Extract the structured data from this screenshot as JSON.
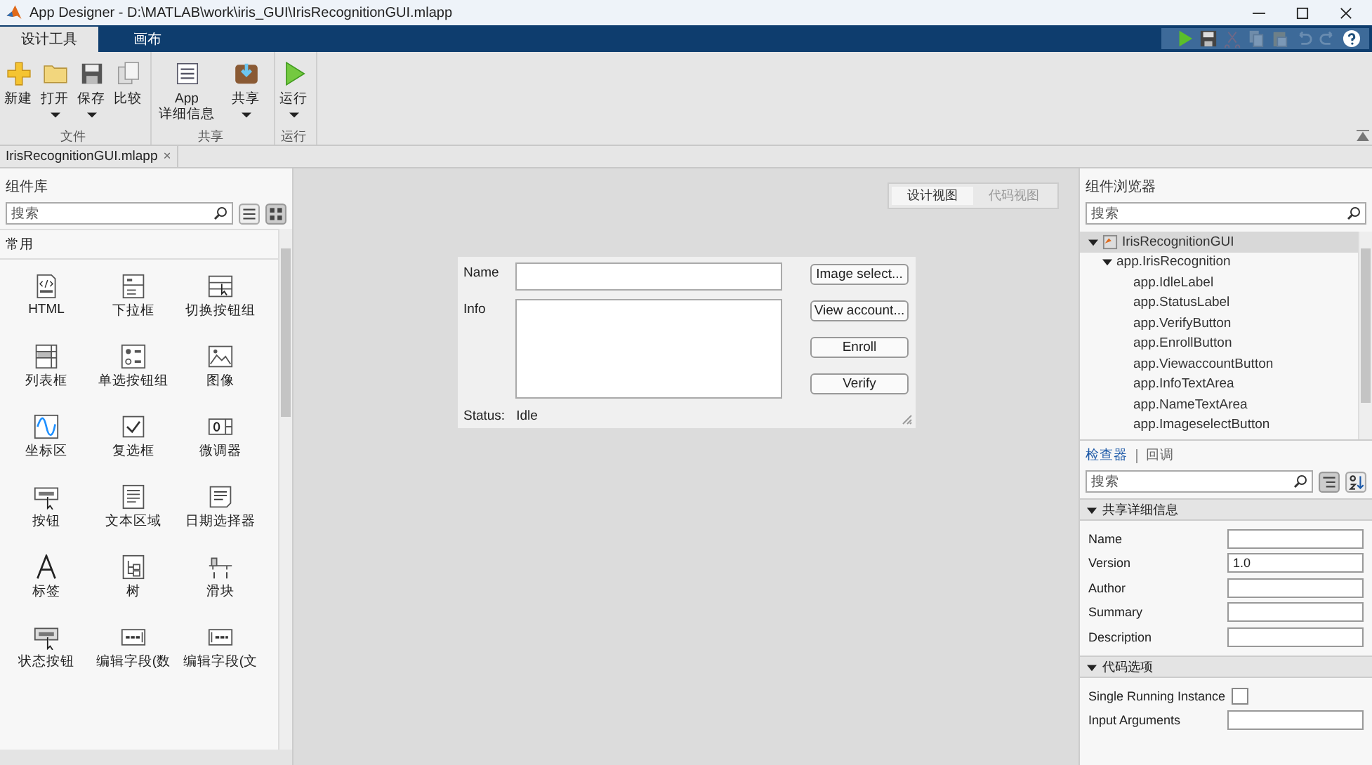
{
  "window": {
    "title": "App Designer - D:\\MATLAB\\work\\iris_GUI\\IrisRecognitionGUI.mlapp"
  },
  "ribbon_tabs": [
    {
      "label": "设计工具",
      "selected": true
    },
    {
      "label": "画布",
      "selected": false
    }
  ],
  "quick_access": [
    {
      "kind": "run",
      "disabled": false
    },
    {
      "kind": "save",
      "disabled": false
    },
    {
      "kind": "cut",
      "disabled": true
    },
    {
      "kind": "copy",
      "disabled": true
    },
    {
      "kind": "paste",
      "disabled": true
    },
    {
      "kind": "undo",
      "disabled": true
    },
    {
      "kind": "redo",
      "disabled": true
    },
    {
      "kind": "help",
      "disabled": false
    }
  ],
  "toolstrip_groups": [
    {
      "title": "文件",
      "buttons": [
        {
          "kind": "new",
          "label": "新建",
          "dropdown": false
        },
        {
          "kind": "open",
          "label": "打开",
          "dropdown": true
        },
        {
          "kind": "save",
          "label": "保存",
          "dropdown": true
        },
        {
          "kind": "compare",
          "label": "比较",
          "dropdown": false
        }
      ]
    },
    {
      "title": "共享",
      "buttons": [
        {
          "kind": "details",
          "label": "App\n详细信息",
          "dropdown": false
        },
        {
          "kind": "share",
          "label": "共享",
          "dropdown": true
        }
      ]
    },
    {
      "title": "运行",
      "buttons": [
        {
          "kind": "run",
          "label": "运行",
          "dropdown": true
        }
      ]
    }
  ],
  "document_tab": {
    "label": "IrisRecognitionGUI.mlapp",
    "close": "×"
  },
  "component_library": {
    "title": "组件库",
    "search_placeholder": "搜索",
    "category": "常用",
    "items": [
      {
        "kind": "html",
        "label": "HTML"
      },
      {
        "kind": "dropdown",
        "label": "下拉框"
      },
      {
        "kind": "toggle-group",
        "label": "切换按钮组"
      },
      {
        "kind": "listbox",
        "label": "列表框"
      },
      {
        "kind": "radio-group",
        "label": "单选按钮组"
      },
      {
        "kind": "image",
        "label": "图像"
      },
      {
        "kind": "axes",
        "label": "坐标区"
      },
      {
        "kind": "checkbox",
        "label": "复选框"
      },
      {
        "kind": "spinner",
        "label": "微调器"
      },
      {
        "kind": "button",
        "label": "按钮"
      },
      {
        "kind": "textarea",
        "label": "文本区域"
      },
      {
        "kind": "datepicker",
        "label": "日期选择器"
      },
      {
        "kind": "label",
        "label": "标签"
      },
      {
        "kind": "tree",
        "label": "树"
      },
      {
        "kind": "slider",
        "label": "滑块"
      },
      {
        "kind": "state-button",
        "label": "状态按钮"
      },
      {
        "kind": "numeric-field",
        "label": "编辑字段(数"
      },
      {
        "kind": "text-field",
        "label": "编辑字段(文"
      }
    ]
  },
  "view_switch": [
    {
      "label": "设计视图",
      "selected": true
    },
    {
      "label": "代码视图",
      "selected": false
    }
  ],
  "app_canvas": {
    "name_label": "Name",
    "info_label": "Info",
    "status_label": "Status:",
    "status_value": "Idle",
    "buttons": [
      "Image select...",
      "View account...",
      "Enroll",
      "Verify"
    ]
  },
  "component_browser": {
    "title": "组件浏览器",
    "search_placeholder": "搜索",
    "tree": [
      {
        "label": "IrisRecognitionGUI",
        "selected": true,
        "expanded": true,
        "children": [
          {
            "label": "app.IrisRecognition",
            "selected": false,
            "expanded": true,
            "children": [
              {
                "label": "app.IdleLabel",
                "selected": false
              },
              {
                "label": "app.StatusLabel",
                "selected": false
              },
              {
                "label": "app.VerifyButton",
                "selected": false
              },
              {
                "label": "app.EnrollButton",
                "selected": false
              },
              {
                "label": "app.ViewaccountButton",
                "selected": false
              },
              {
                "label": "app.InfoTextArea",
                "selected": false
              },
              {
                "label": "app.NameTextArea",
                "selected": false
              },
              {
                "label": "app.ImageselectButton",
                "selected": false
              }
            ]
          }
        ]
      }
    ]
  },
  "inspector": {
    "tabs": [
      {
        "label": "检查器",
        "selected": true
      },
      {
        "label": "回调",
        "selected": false
      }
    ],
    "search_placeholder": "搜索",
    "sections": [
      {
        "title": "共享详细信息",
        "expanded": true,
        "rows": [
          {
            "kind": "field",
            "label": "Name"
          },
          {
            "kind": "field",
            "label": "Version",
            "value": "1.0"
          },
          {
            "kind": "field",
            "label": "Author"
          },
          {
            "kind": "field",
            "label": "Summary"
          },
          {
            "kind": "field",
            "label": "Description"
          }
        ]
      },
      {
        "title": "代码选项",
        "expanded": true,
        "rows": [
          {
            "kind": "checkbox",
            "label": "Single Running Instance",
            "checked": false
          },
          {
            "kind": "field",
            "label": "Input Arguments"
          }
        ]
      }
    ]
  }
}
